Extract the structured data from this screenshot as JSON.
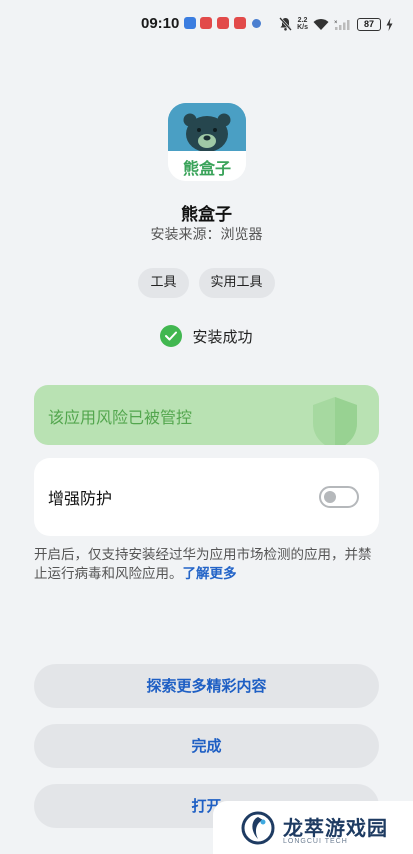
{
  "status_bar": {
    "time": "09:10",
    "net_speed_value": "2.2",
    "net_speed_unit": "K/s",
    "battery_level": "87"
  },
  "app": {
    "name": "熊盒子",
    "source": "安装来源：浏览器",
    "icon_caption": "熊盒子"
  },
  "tags": [
    "工具",
    "实用工具"
  ],
  "install_status": "安装成功",
  "risk_banner": {
    "text": "该应用风险已被管控"
  },
  "enhanced_protection": {
    "label": "增强防护",
    "enabled": false
  },
  "description": {
    "text": "开启后，仅支持安装经过华为应用市场检测的应用，并禁止运行病毒和风险应用。",
    "link": "了解更多"
  },
  "buttons": {
    "explore": "探索更多精彩内容",
    "done": "完成",
    "open": "打开"
  },
  "watermark": {
    "title": "龙萃游戏园",
    "subtitle": "LONGCUI TECH"
  },
  "colors": {
    "success_green": "#41b750",
    "banner_bg": "#b9e2b3",
    "link_blue": "#2364c8"
  }
}
